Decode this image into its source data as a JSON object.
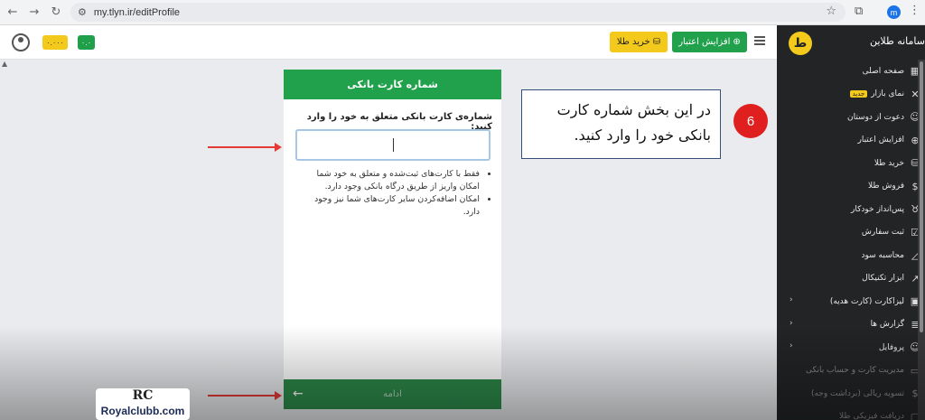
{
  "browser": {
    "url": "my.tlyn.ir/editProfile",
    "profile_initial": "m",
    "icons": [
      "back-icon",
      "forward-icon",
      "reload-icon",
      "tune-icon",
      "star-icon",
      "extensions-icon",
      "kebab-icon"
    ]
  },
  "header": {
    "gold_badge": "۰.۰۰۰",
    "green_badge": "۰.۰",
    "buy_gold": "خرید طلا",
    "increase_credit": "افزایش اعتبار"
  },
  "card": {
    "title": "شماره کارت بانکی",
    "label": "شماره‌ی کارت بانکی متعلق به خود را وارد کنید:",
    "input_value": "",
    "notes": [
      "فقط با کارت‌های ثبت‌شده و متعلق به خود شما امکان واریز از طریق درگاه بانکی وجود دارد.",
      "امکان اضافه‌کردن سایر کارت‌های شما نیز وجود دارد."
    ],
    "continue": "ادامه"
  },
  "callout": {
    "text": "در این بخش شماره کارت بانکی خود را وارد کنید.",
    "step": "6"
  },
  "sidebar": {
    "logo": "ط",
    "title": "سامانه طلاین",
    "items": [
      {
        "label": "صفحه اصلی",
        "icon": "grid-icon"
      },
      {
        "label": "نمای بازار",
        "icon": "market-icon",
        "badge": "جدید"
      },
      {
        "label": "دعوت از دوستان",
        "icon": "invite-icon"
      },
      {
        "label": "افزایش اعتبار",
        "icon": "plus-circle-icon"
      },
      {
        "label": "خرید طلا",
        "icon": "coins-icon"
      },
      {
        "label": "فروش طلا",
        "icon": "money-bag-icon"
      },
      {
        "label": "پس‌انداز خودکار",
        "icon": "piggy-bank-icon"
      },
      {
        "label": "ثبت سفارش",
        "icon": "clipboard-icon"
      },
      {
        "label": "محاسبه سود",
        "icon": "chart-icon"
      },
      {
        "label": "ابزار تکنیکال",
        "icon": "line-chart-icon"
      },
      {
        "label": "لیزاکارت (کارت هدیه)",
        "icon": "gift-icon",
        "expand": true
      },
      {
        "label": "گزارش ها",
        "icon": "report-icon",
        "expand": true
      },
      {
        "label": "پروفایل",
        "icon": "user-icon",
        "expand": true
      },
      {
        "label": "مدیریت کارت و حساب بانکی",
        "icon": "card-icon",
        "dim": true
      },
      {
        "label": "تسویه ریالی (برداشت وجه)",
        "icon": "dollar-icon",
        "dim": true
      },
      {
        "label": "دریافت فیزیکی طلا",
        "icon": "box-icon",
        "dim": true
      }
    ]
  },
  "watermark": {
    "logo": "RC",
    "site": "Royalclubb.com"
  },
  "colors": {
    "green": "#21a14c",
    "gold": "#f3c91b",
    "sidebar": "#232426",
    "red": "#e0201e"
  }
}
